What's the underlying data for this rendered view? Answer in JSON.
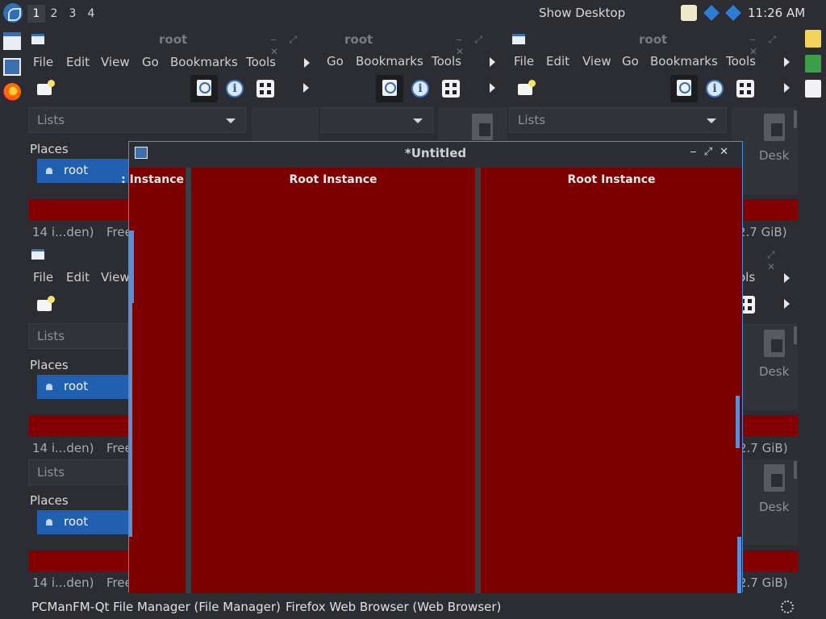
{
  "panel": {
    "workspaces": [
      "1",
      "2",
      "3",
      "4"
    ],
    "show_desktop": "Show Desktop",
    "clock": "11:26 AM"
  },
  "file_manager": {
    "title": "root",
    "menu": [
      "File",
      "Edit",
      "View",
      "Go",
      "Bookmarks",
      "Tools"
    ],
    "lists_label": "Lists",
    "places_label": "Places",
    "root_item": "root",
    "status_left": "14 i...den)",
    "status_free": "Free",
    "status_right": "2.7 GiB)",
    "desk_label": "Desk",
    "partial_menu_tools": "ols"
  },
  "editor": {
    "title": "*Untitled",
    "column_partial": ": Instance",
    "column_2": "Root Instance",
    "column_3": "Root Instance"
  },
  "taskbar": {
    "file_manager": "PCManFM-Qt File Manager (File Manager)",
    "firefox": "Firefox Web Browser (Web Browser)"
  },
  "colors": {
    "accent": "#2160b0",
    "dark_red": "#7c0000",
    "background": "#2b2d33"
  }
}
